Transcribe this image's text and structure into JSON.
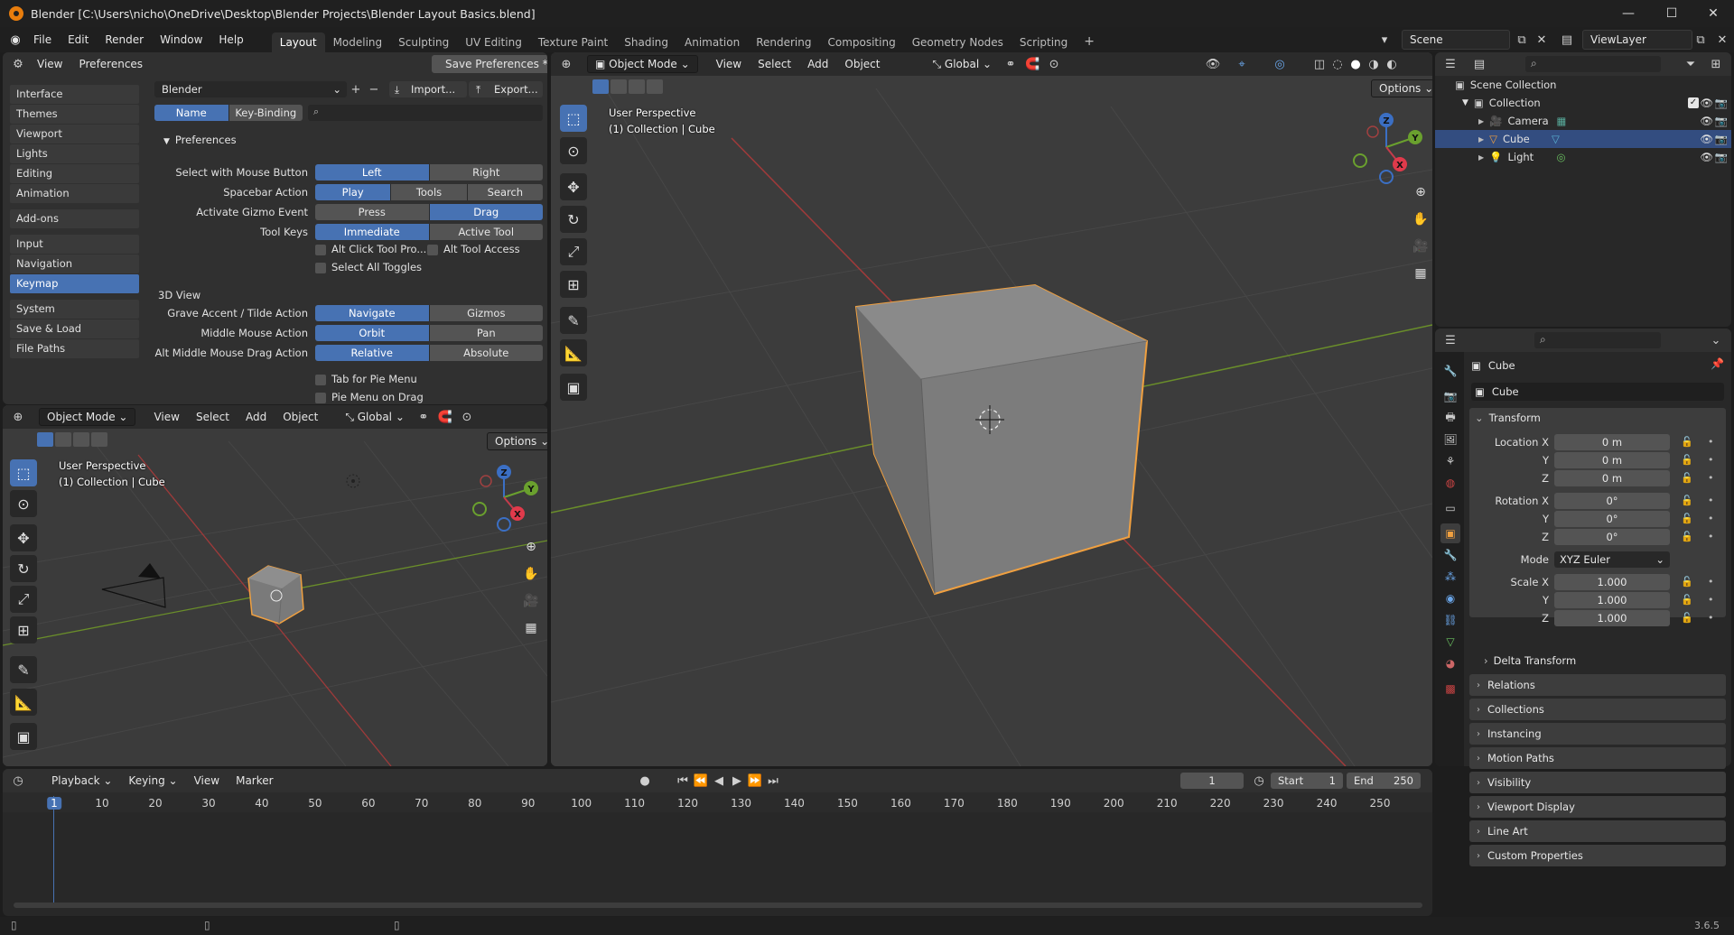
{
  "window": {
    "title": "Blender [C:\\Users\\nicho\\OneDrive\\Desktop\\Blender Projects\\Blender Layout Basics.blend]",
    "minimize": "—",
    "maximize": "☐",
    "close": "✕"
  },
  "menus": [
    "File",
    "Edit",
    "Render",
    "Window",
    "Help"
  ],
  "workspaces": [
    "Layout",
    "Modeling",
    "Sculpting",
    "UV Editing",
    "Texture Paint",
    "Shading",
    "Animation",
    "Rendering",
    "Compositing",
    "Geometry Nodes",
    "Scripting"
  ],
  "scene": {
    "name": "Scene",
    "view_layer": "ViewLayer"
  },
  "prefs": {
    "header": {
      "view": "View",
      "preferences": "Preferences",
      "save": "Save Preferences *"
    },
    "sidebar": [
      "Interface",
      "Themes",
      "Viewport",
      "Lights",
      "Editing",
      "Animation",
      "Add-ons",
      "Input",
      "Navigation",
      "Keymap",
      "System",
      "Save & Load",
      "File Paths"
    ],
    "active_sidebar": "Keymap",
    "keymap_preset": "Blender",
    "import": "Import...",
    "export": "Export...",
    "filter_tabs": [
      "Name",
      "Key-Binding"
    ],
    "section_preferences": "Preferences",
    "rows": [
      {
        "label": "Select with Mouse Button",
        "options": [
          "Left",
          "Right"
        ],
        "active": 0
      },
      {
        "label": "Spacebar Action",
        "options": [
          "Play",
          "Tools",
          "Search"
        ],
        "active": 0
      },
      {
        "label": "Activate Gizmo Event",
        "options": [
          "Press",
          "Drag"
        ],
        "active": 1
      },
      {
        "label": "Tool Keys",
        "options": [
          "Immediate",
          "Active Tool"
        ],
        "active": 0
      }
    ],
    "checks1": [
      {
        "label": "Alt Click Tool Pro...",
        "on": false
      },
      {
        "label": "Alt Tool Access",
        "on": false
      },
      {
        "label": "Select All Toggles",
        "on": false
      }
    ],
    "section_3dview": "3D View",
    "rows3d": [
      {
        "label": "Grave Accent / Tilde Action",
        "options": [
          "Navigate",
          "Gizmos"
        ],
        "active": 0
      },
      {
        "label": "Middle Mouse Action",
        "options": [
          "Orbit",
          "Pan"
        ],
        "active": 0
      },
      {
        "label": "Alt Middle Mouse Drag Action",
        "options": [
          "Relative",
          "Absolute"
        ],
        "active": 0
      }
    ],
    "checks2": [
      {
        "label": "Tab for Pie Menu",
        "on": false
      },
      {
        "label": "Pie Menu on Drag",
        "on": false
      }
    ]
  },
  "viewport_small": {
    "mode": "Object Mode",
    "menus": [
      "View",
      "Select",
      "Add",
      "Object"
    ],
    "orientation": "Global",
    "options": "Options",
    "line1": "User Perspective",
    "line2": "(1) Collection | Cube"
  },
  "viewport_main": {
    "mode": "Object Mode",
    "menus": [
      "View",
      "Select",
      "Add",
      "Object"
    ],
    "orientation": "Global",
    "options": "Options",
    "line1": "User Perspective",
    "line2": "(1) Collection | Cube"
  },
  "gizmo": {
    "x": "X",
    "y": "Y",
    "z": "Z"
  },
  "outliner": {
    "root": "Scene Collection",
    "collection": "Collection",
    "items": [
      {
        "name": "Camera",
        "selected": false
      },
      {
        "name": "Cube",
        "selected": true
      },
      {
        "name": "Light",
        "selected": false
      }
    ]
  },
  "properties": {
    "object_name": "Cube",
    "data_name": "Cube",
    "transform": "Transform",
    "location_label": "Location X",
    "rotation_label": "Rotation X",
    "scale_label": "Scale X",
    "y": "Y",
    "z": "Z",
    "location": [
      "0 m",
      "0 m",
      "0 m"
    ],
    "rotation": [
      "0°",
      "0°",
      "0°"
    ],
    "mode_label": "Mode",
    "mode": "XYZ Euler",
    "scale": [
      "1.000",
      "1.000",
      "1.000"
    ],
    "delta": "Delta Transform",
    "panels": [
      "Relations",
      "Collections",
      "Instancing",
      "Motion Paths",
      "Visibility",
      "Viewport Display",
      "Line Art",
      "Custom Properties"
    ]
  },
  "timeline": {
    "menus": [
      "Playback",
      "Keying",
      "View",
      "Marker"
    ],
    "current_frame": "1",
    "start_label": "Start",
    "start": "1",
    "end_label": "End",
    "end": "250",
    "ticks": [
      "1",
      "10",
      "20",
      "30",
      "40",
      "50",
      "60",
      "70",
      "80",
      "90",
      "100",
      "110",
      "120",
      "130",
      "140",
      "150",
      "160",
      "170",
      "180",
      "190",
      "200",
      "210",
      "220",
      "230",
      "240",
      "250"
    ]
  },
  "statusbar": {
    "version": "3.6.5"
  }
}
